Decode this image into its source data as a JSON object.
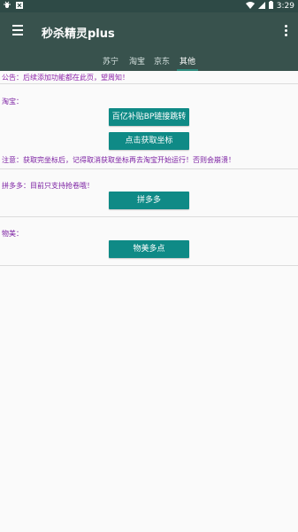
{
  "status_bar": {
    "left_icons": [
      "bug-icon",
      "close-box-icon"
    ],
    "time": "3:29"
  },
  "app_bar": {
    "title": "秒杀精灵plus"
  },
  "tabs": [
    {
      "label": "苏宁"
    },
    {
      "label": "淘宝"
    },
    {
      "label": "京东"
    },
    {
      "label": "其他",
      "active": true
    }
  ],
  "content": {
    "notice": "公告：后续添加功能都在此页，望周知！",
    "taobao": {
      "label": "淘宝：",
      "button_bp": "百亿补贴BP链接跳转",
      "button_coords": "点击获取坐标",
      "warning": "注意：获取完坐标后，记得取消获取坐标再去淘宝开始运行！否则会崩溃！"
    },
    "pinduoduo": {
      "label": "拼多多：目前只支持抢卷哦！",
      "button": "拼多多"
    },
    "wumei": {
      "label": "物美：",
      "button": "物美多点"
    }
  },
  "colors": {
    "app_bar": "#38524d",
    "button": "#0f8a86",
    "label_text": "#7b1fa2"
  }
}
